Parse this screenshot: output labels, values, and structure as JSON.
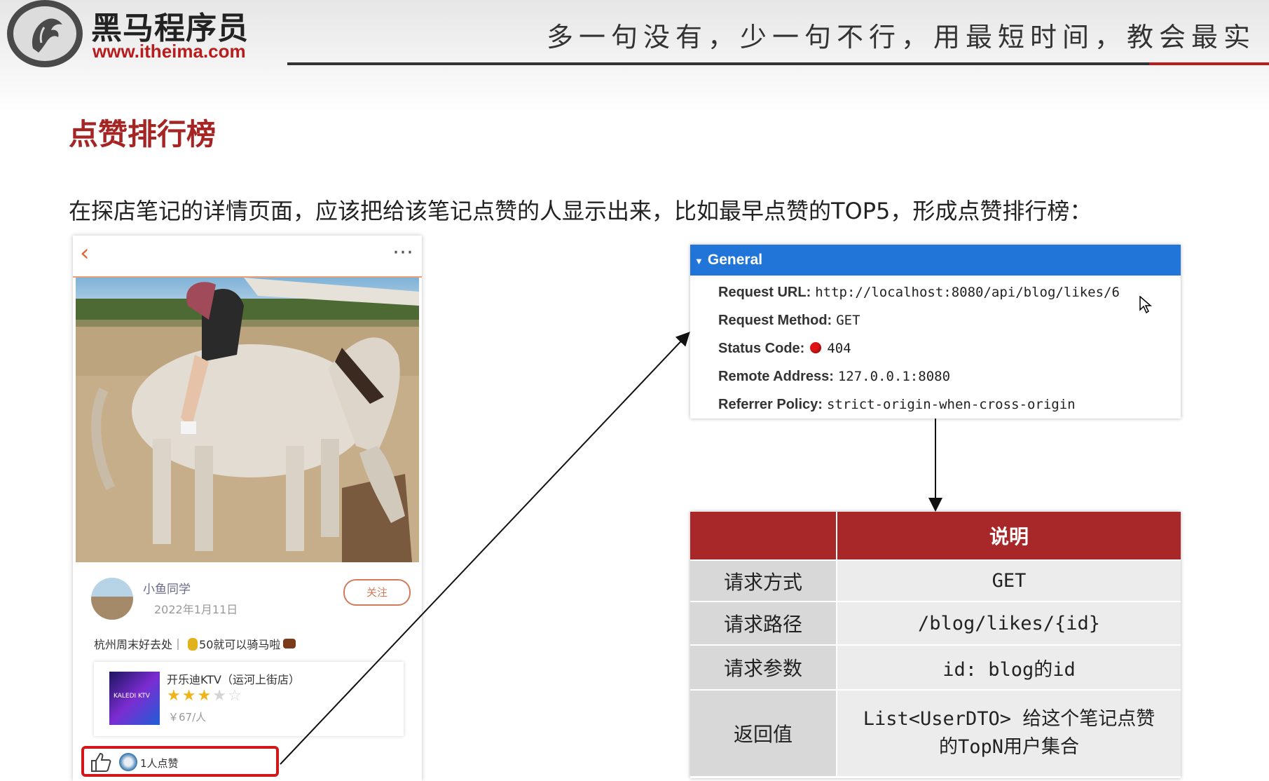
{
  "header": {
    "logo_cn": "黑马程序员",
    "logo_url": "www.itheima.com",
    "slogan": "多一句没有，少一句不行，用最短时间，教会最实"
  },
  "slide": {
    "title": "点赞排行榜",
    "description": "在探店笔记的详情页面，应该把给该笔记点赞的人显示出来，比如最早点赞的TOP5，形成点赞排行榜："
  },
  "phone": {
    "author_name": "小鱼同学",
    "date": "2022年1月11日",
    "follow_label": "关注",
    "post_text_before": "杭州周末好去处｜",
    "post_text_after": "50就可以骑马啦",
    "shop_name": "开乐迪KTV（运河上街店）",
    "shop_logo_text": "KALEDI KTV",
    "shop_rating": 3,
    "shop_rating_max": 5,
    "shop_price": "￥67/人",
    "like_text": "1人点赞"
  },
  "general": {
    "header": "General",
    "rows": [
      {
        "key": "Request URL:",
        "value": "http://localhost:8080/api/blog/likes/6"
      },
      {
        "key": "Request Method:",
        "value": "GET"
      },
      {
        "key": "Status Code:",
        "value": "404"
      },
      {
        "key": "Remote Address:",
        "value": "127.0.0.1:8080"
      },
      {
        "key": "Referrer Policy:",
        "value": "strict-origin-when-cross-origin"
      }
    ]
  },
  "spec_table": {
    "header_label": "",
    "header_value": "说明",
    "rows": [
      {
        "label": "请求方式",
        "value": "GET"
      },
      {
        "label": "请求路径",
        "value": "/blog/likes/{id}"
      },
      {
        "label": "请求参数",
        "value": "id: blog的id"
      },
      {
        "label": "返回值",
        "value": "List<UserDTO> 给这个笔记点赞的TopN用户集合"
      }
    ]
  },
  "colors": {
    "accent_red": "#a8282a",
    "devtools_blue": "#2275d8",
    "status_error": "#e01414"
  }
}
